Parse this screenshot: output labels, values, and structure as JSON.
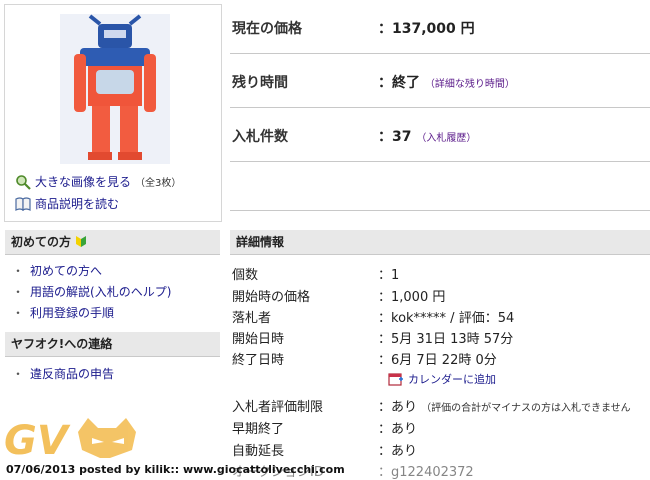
{
  "item_image": {
    "alt": "robot toy photo"
  },
  "image_links": {
    "larger": "大きな画像を見る",
    "larger_count": "（全3枚）",
    "description": "商品説明を読む"
  },
  "price_table": [
    {
      "label": "現在の価格",
      "value": "：137,000 円",
      "sub": ""
    },
    {
      "label": "残り時間",
      "value": "：終了",
      "sub": "（詳細な残り時間）"
    },
    {
      "label": "入札件数",
      "value": "：37",
      "sub": "（入札履歴）"
    }
  ],
  "sidebar": {
    "beginners": {
      "title": "初めての方",
      "items": [
        "初めての方へ",
        "用語の解説(入札のヘルプ)",
        "利用登録の手順"
      ]
    },
    "contact": {
      "title": "ヤフオク!への連絡",
      "items": [
        "違反商品の申告"
      ]
    }
  },
  "details": {
    "title": "詳細情報",
    "rows": [
      {
        "label": "個数",
        "value": "：1",
        "note": ""
      },
      {
        "label": "開始時の価格",
        "value": "：1,000 円",
        "note": ""
      },
      {
        "label": "落札者",
        "value": "：kok***** / 評価：54",
        "note": ""
      },
      {
        "label": "開始日時",
        "value": "：5月 31日 13時 57分",
        "note": ""
      },
      {
        "label": "終了日時",
        "value": "：6月 7日 22時 0分",
        "note": ""
      },
      {
        "label": "入札者評価制限",
        "value": "：あり",
        "note": "（評価の合計がマイナスの方は入札できません"
      },
      {
        "label": "早期終了",
        "value": "：あり",
        "note": ""
      },
      {
        "label": "自動延長",
        "value": "：あり",
        "note": ""
      },
      {
        "label": "オークションID",
        "value": "：g122402372",
        "note": ""
      }
    ],
    "calendar_link": "カレンダーに追加"
  },
  "watermark": {
    "logo": "GV",
    "credit": "07/06/2013 posted by kilik:: www.giocattolivecchi.com"
  },
  "colors": {
    "link": "#1a1a8c",
    "sub_link": "#5a1a8a",
    "header_bg": "#e8e8e8",
    "watermark": "#f2b640"
  }
}
